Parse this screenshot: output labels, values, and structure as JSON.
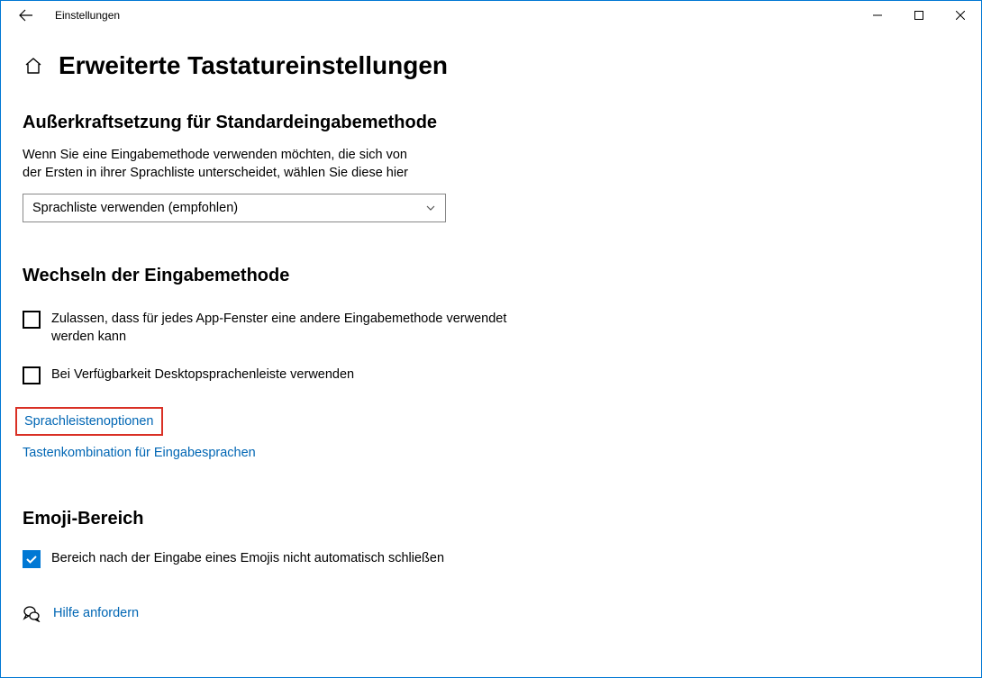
{
  "titlebar": {
    "title": "Einstellungen"
  },
  "page": {
    "title": "Erweiterte Tastatureinstellungen"
  },
  "section1": {
    "title": "Außerkraftsetzung für Standardeingabemethode",
    "desc": "Wenn Sie eine Eingabemethode verwenden möchten, die sich von der Ersten in ihrer Sprachliste unterscheidet, wählen Sie diese hier",
    "dropdown_value": "Sprachliste verwenden (empfohlen)"
  },
  "section2": {
    "title": "Wechseln der Eingabemethode",
    "checkbox1_label": "Zulassen, dass für jedes App-Fenster eine andere Eingabemethode verwendet werden kann",
    "checkbox2_label": "Bei Verfügbarkeit Desktopsprachenleiste verwenden",
    "link1": "Sprachleistenoptionen",
    "link2": "Tastenkombination für Eingabesprachen"
  },
  "section3": {
    "title": "Emoji-Bereich",
    "checkbox1_label": "Bereich nach der Eingabe eines Emojis nicht automatisch schließen"
  },
  "help": {
    "label": "Hilfe anfordern"
  }
}
